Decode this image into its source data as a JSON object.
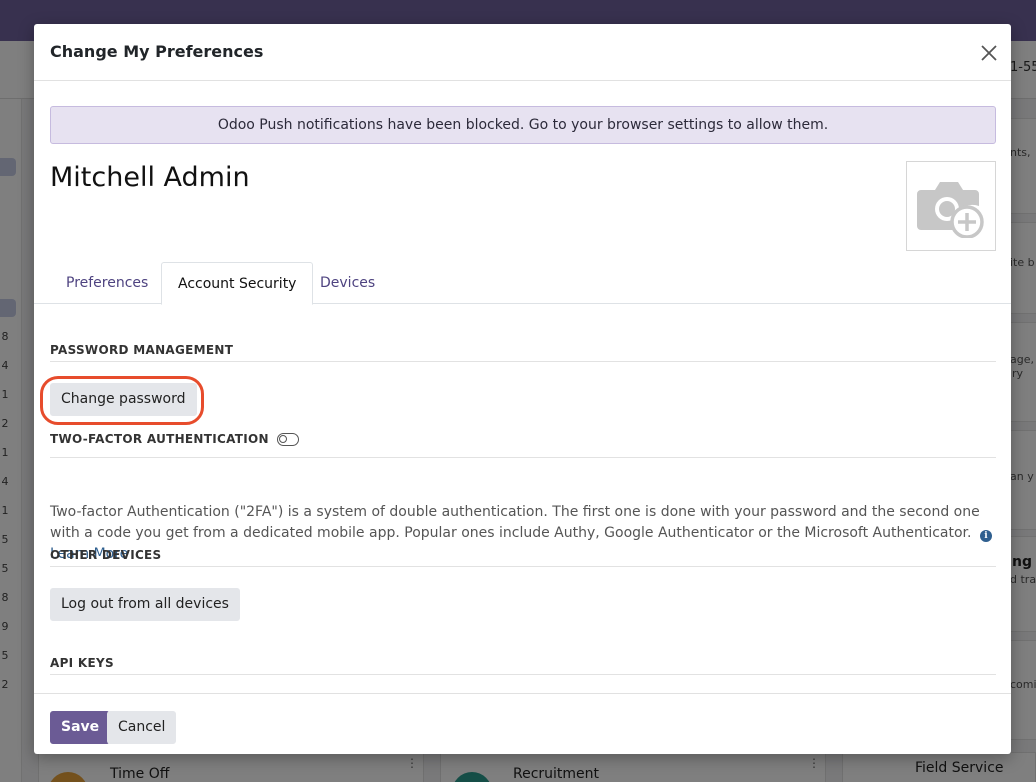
{
  "background": {
    "left_numbers": [
      "8",
      "4",
      "1",
      "2",
      "1",
      "4",
      "1",
      "5",
      "5",
      "8",
      "9",
      "5",
      "2"
    ],
    "right_fragments": [
      "1-55",
      "nts,",
      "ite b",
      "age,",
      "ry",
      "an y",
      "ng",
      "d tra",
      "comi"
    ],
    "bottom_cards": {
      "left_title": "Time Off",
      "middle_title": "Recruitment",
      "right_title": "Field Service",
      "menu_glyph": "⋮"
    }
  },
  "modal": {
    "title": "Change My Preferences",
    "alert": "Odoo Push notifications have been blocked. Go to your browser settings to allow them.",
    "user_name": "Mitchell Admin",
    "avatar_icon": "camera-plus-icon",
    "tabs": [
      {
        "label": "Preferences",
        "active": false
      },
      {
        "label": "Account Security",
        "active": true
      },
      {
        "label": "Devices",
        "active": false
      }
    ],
    "password_section": {
      "title": "PASSWORD MANAGEMENT",
      "button": "Change password"
    },
    "twofa_section": {
      "title": "TWO-FACTOR AUTHENTICATION",
      "enabled": false,
      "description": "Two-factor Authentication (\"2FA\") is a system of double authentication. The first one is done with your password and the second one with a code you get from a dedicated mobile app. Popular ones include Authy, Google Authenticator or the Microsoft Authenticator.",
      "learn_more": "Learn More"
    },
    "devices_section": {
      "title": "OTHER DEVICES",
      "button": "Log out from all devices"
    },
    "api_section": {
      "title": "API KEYS"
    },
    "footer": {
      "save": "Save",
      "cancel": "Cancel"
    }
  },
  "colors": {
    "brand": "#71639e",
    "primary_button": "#6b5b95",
    "highlight_ring": "#e74c2c",
    "alert_bg": "#e7e2f1"
  }
}
